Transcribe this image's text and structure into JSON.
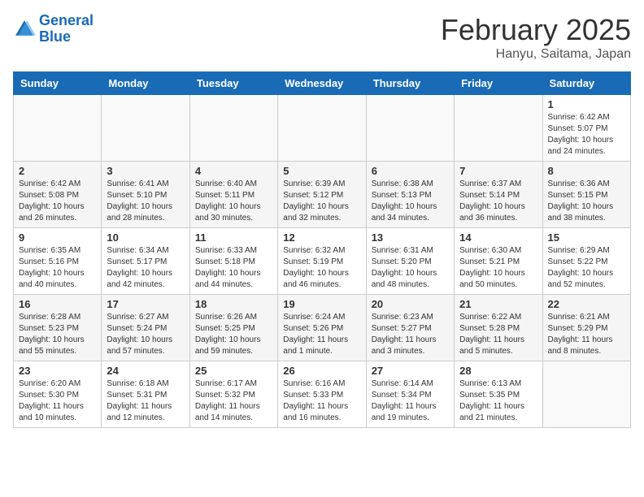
{
  "header": {
    "logo_line1": "General",
    "logo_line2": "Blue",
    "month": "February 2025",
    "location": "Hanyu, Saitama, Japan"
  },
  "weekdays": [
    "Sunday",
    "Monday",
    "Tuesday",
    "Wednesday",
    "Thursday",
    "Friday",
    "Saturday"
  ],
  "weeks": [
    [
      {
        "day": "",
        "info": ""
      },
      {
        "day": "",
        "info": ""
      },
      {
        "day": "",
        "info": ""
      },
      {
        "day": "",
        "info": ""
      },
      {
        "day": "",
        "info": ""
      },
      {
        "day": "",
        "info": ""
      },
      {
        "day": "1",
        "info": "Sunrise: 6:42 AM\nSunset: 5:07 PM\nDaylight: 10 hours and 24 minutes."
      }
    ],
    [
      {
        "day": "2",
        "info": "Sunrise: 6:42 AM\nSunset: 5:08 PM\nDaylight: 10 hours and 26 minutes."
      },
      {
        "day": "3",
        "info": "Sunrise: 6:41 AM\nSunset: 5:10 PM\nDaylight: 10 hours and 28 minutes."
      },
      {
        "day": "4",
        "info": "Sunrise: 6:40 AM\nSunset: 5:11 PM\nDaylight: 10 hours and 30 minutes."
      },
      {
        "day": "5",
        "info": "Sunrise: 6:39 AM\nSunset: 5:12 PM\nDaylight: 10 hours and 32 minutes."
      },
      {
        "day": "6",
        "info": "Sunrise: 6:38 AM\nSunset: 5:13 PM\nDaylight: 10 hours and 34 minutes."
      },
      {
        "day": "7",
        "info": "Sunrise: 6:37 AM\nSunset: 5:14 PM\nDaylight: 10 hours and 36 minutes."
      },
      {
        "day": "8",
        "info": "Sunrise: 6:36 AM\nSunset: 5:15 PM\nDaylight: 10 hours and 38 minutes."
      }
    ],
    [
      {
        "day": "9",
        "info": "Sunrise: 6:35 AM\nSunset: 5:16 PM\nDaylight: 10 hours and 40 minutes."
      },
      {
        "day": "10",
        "info": "Sunrise: 6:34 AM\nSunset: 5:17 PM\nDaylight: 10 hours and 42 minutes."
      },
      {
        "day": "11",
        "info": "Sunrise: 6:33 AM\nSunset: 5:18 PM\nDaylight: 10 hours and 44 minutes."
      },
      {
        "day": "12",
        "info": "Sunrise: 6:32 AM\nSunset: 5:19 PM\nDaylight: 10 hours and 46 minutes."
      },
      {
        "day": "13",
        "info": "Sunrise: 6:31 AM\nSunset: 5:20 PM\nDaylight: 10 hours and 48 minutes."
      },
      {
        "day": "14",
        "info": "Sunrise: 6:30 AM\nSunset: 5:21 PM\nDaylight: 10 hours and 50 minutes."
      },
      {
        "day": "15",
        "info": "Sunrise: 6:29 AM\nSunset: 5:22 PM\nDaylight: 10 hours and 52 minutes."
      }
    ],
    [
      {
        "day": "16",
        "info": "Sunrise: 6:28 AM\nSunset: 5:23 PM\nDaylight: 10 hours and 55 minutes."
      },
      {
        "day": "17",
        "info": "Sunrise: 6:27 AM\nSunset: 5:24 PM\nDaylight: 10 hours and 57 minutes."
      },
      {
        "day": "18",
        "info": "Sunrise: 6:26 AM\nSunset: 5:25 PM\nDaylight: 10 hours and 59 minutes."
      },
      {
        "day": "19",
        "info": "Sunrise: 6:24 AM\nSunset: 5:26 PM\nDaylight: 11 hours and 1 minute."
      },
      {
        "day": "20",
        "info": "Sunrise: 6:23 AM\nSunset: 5:27 PM\nDaylight: 11 hours and 3 minutes."
      },
      {
        "day": "21",
        "info": "Sunrise: 6:22 AM\nSunset: 5:28 PM\nDaylight: 11 hours and 5 minutes."
      },
      {
        "day": "22",
        "info": "Sunrise: 6:21 AM\nSunset: 5:29 PM\nDaylight: 11 hours and 8 minutes."
      }
    ],
    [
      {
        "day": "23",
        "info": "Sunrise: 6:20 AM\nSunset: 5:30 PM\nDaylight: 11 hours and 10 minutes."
      },
      {
        "day": "24",
        "info": "Sunrise: 6:18 AM\nSunset: 5:31 PM\nDaylight: 11 hours and 12 minutes."
      },
      {
        "day": "25",
        "info": "Sunrise: 6:17 AM\nSunset: 5:32 PM\nDaylight: 11 hours and 14 minutes."
      },
      {
        "day": "26",
        "info": "Sunrise: 6:16 AM\nSunset: 5:33 PM\nDaylight: 11 hours and 16 minutes."
      },
      {
        "day": "27",
        "info": "Sunrise: 6:14 AM\nSunset: 5:34 PM\nDaylight: 11 hours and 19 minutes."
      },
      {
        "day": "28",
        "info": "Sunrise: 6:13 AM\nSunset: 5:35 PM\nDaylight: 11 hours and 21 minutes."
      },
      {
        "day": "",
        "info": ""
      }
    ]
  ]
}
